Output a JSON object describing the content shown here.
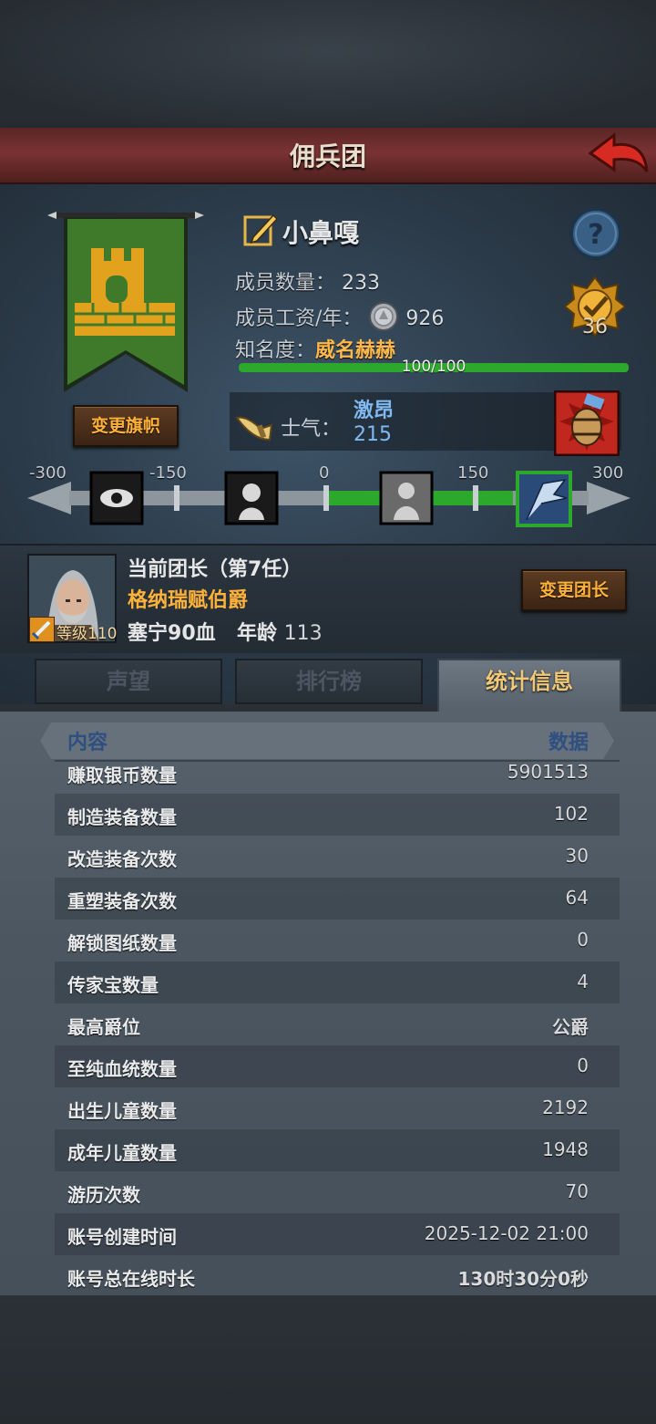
{
  "header": {
    "title": "佣兵团"
  },
  "company": {
    "name": "小鼻嘎",
    "members_label": "成员数量：",
    "members_value": "233",
    "salary_label": "成员工资/年：",
    "salary_value": "926",
    "fame_label": "知名度：",
    "fame_value": "威名赫赫",
    "fame_progress_text": "100/100",
    "fame_progress": 1.0,
    "rank_number": "36",
    "change_banner_label": "变更旗帜"
  },
  "morale": {
    "label": "士气：",
    "state": "激昂",
    "value": "215",
    "scale_ticks": [
      "-300",
      "-150",
      "0",
      "150",
      "300"
    ],
    "scale_value": 215
  },
  "leader": {
    "title": "当前团长（第7任）",
    "name": "格纳瑞赋伯爵",
    "level_text": "等级110",
    "stat_name": "塞宁",
    "stat_blood": "90血",
    "age_label": "年龄",
    "age_value": "113",
    "change_leader_label": "变更团长"
  },
  "tabs": [
    {
      "label": "声望",
      "active": false
    },
    {
      "label": "排行榜",
      "active": false
    },
    {
      "label": "统计信息",
      "active": true
    }
  ],
  "table": {
    "header_left": "内容",
    "header_right": "数据",
    "rows": [
      {
        "key": "赚取银币数量",
        "value": "5901513"
      },
      {
        "key": "制造装备数量",
        "value": "102"
      },
      {
        "key": "改造装备次数",
        "value": "30"
      },
      {
        "key": "重塑装备次数",
        "value": "64"
      },
      {
        "key": "解锁图纸数量",
        "value": "0"
      },
      {
        "key": "传家宝数量",
        "value": "4"
      },
      {
        "key": "最高爵位",
        "value": "公爵"
      },
      {
        "key": "至纯血统数量",
        "value": "0"
      },
      {
        "key": "出生儿童数量",
        "value": "2192"
      },
      {
        "key": "成年儿童数量",
        "value": "1948"
      },
      {
        "key": "游历次数",
        "value": "70"
      },
      {
        "key": "账号创建时间",
        "value": "2025-12-02 21:00"
      },
      {
        "key": "账号总在线时长",
        "value": "130时30分0秒"
      }
    ]
  },
  "colors": {
    "title_bar": "#7a3232",
    "banner_green": "#3f7a2a",
    "tower_gold": "#e2a21e",
    "gold_text": "#ffb23a",
    "morale_blue": "#7fb9f0",
    "progress_green": "#2ca82c"
  }
}
